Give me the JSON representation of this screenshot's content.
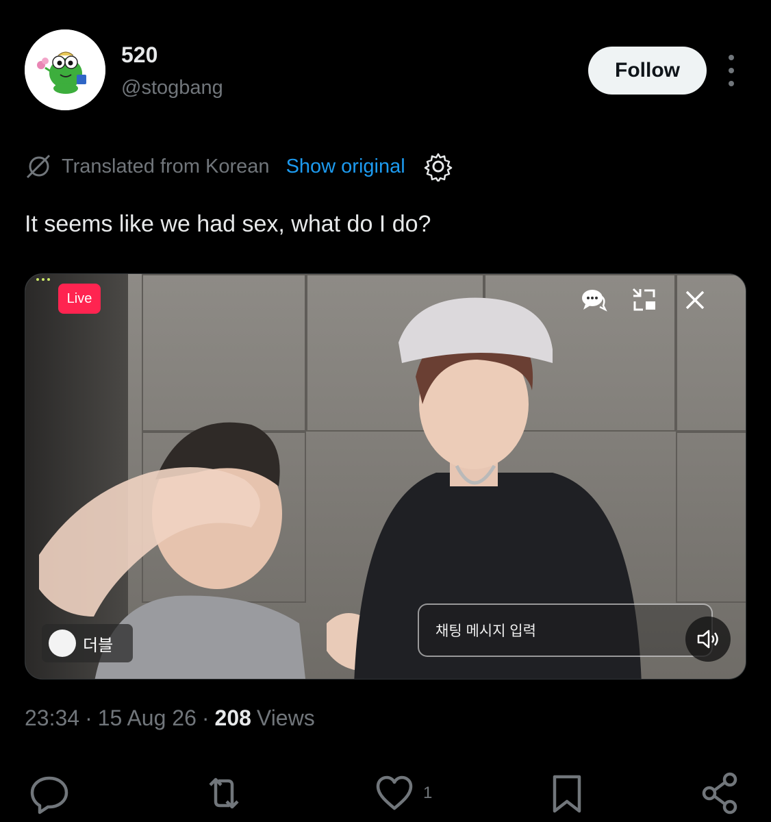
{
  "author": {
    "display_name": "520",
    "handle": "@stogbang"
  },
  "header": {
    "follow_label": "Follow"
  },
  "translation": {
    "label": "Translated from Korean",
    "show_original": "Show original"
  },
  "tweet": {
    "text": "It seems like we had sex, what do I do?"
  },
  "media": {
    "live_label": "Live",
    "couple_name": "더블",
    "chat_placeholder": "채팅 메시지 입력"
  },
  "meta": {
    "time": "23:34",
    "date": "15 Aug 26",
    "views_count": "208",
    "views_label": "Views",
    "separator": "·"
  },
  "actions": {
    "like_count": "1"
  },
  "colors": {
    "background": "#000000",
    "text": "#e7e9ea",
    "muted": "#71767b",
    "link": "#1d9bf0",
    "live": "#ff2450"
  }
}
